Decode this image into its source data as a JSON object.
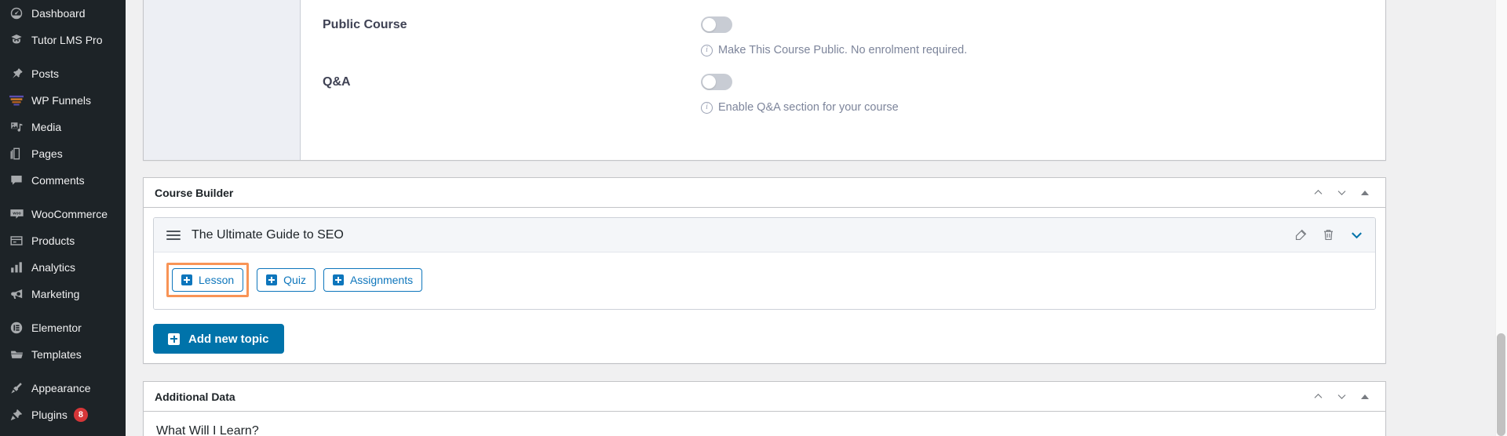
{
  "sidebar": {
    "items": [
      {
        "label": "Dashboard",
        "icon": "dashboard-icon",
        "separator_after": false
      },
      {
        "label": "Tutor LMS Pro",
        "icon": "tutor-lms-icon",
        "separator_after": true
      },
      {
        "label": "Posts",
        "icon": "pin-icon",
        "separator_after": false
      },
      {
        "label": "WP Funnels",
        "icon": "funnel-icon",
        "separator_after": false
      },
      {
        "label": "Media",
        "icon": "media-icon",
        "separator_after": false
      },
      {
        "label": "Pages",
        "icon": "pages-icon",
        "separator_after": false
      },
      {
        "label": "Comments",
        "icon": "comments-icon",
        "separator_after": true
      },
      {
        "label": "WooCommerce",
        "icon": "woocommerce-icon",
        "separator_after": false
      },
      {
        "label": "Products",
        "icon": "products-icon",
        "separator_after": false
      },
      {
        "label": "Analytics",
        "icon": "analytics-icon",
        "separator_after": false
      },
      {
        "label": "Marketing",
        "icon": "marketing-icon",
        "separator_after": true
      },
      {
        "label": "Elementor",
        "icon": "elementor-icon",
        "separator_after": false
      },
      {
        "label": "Templates",
        "icon": "templates-icon",
        "separator_after": true
      },
      {
        "label": "Appearance",
        "icon": "appearance-icon",
        "separator_after": false
      },
      {
        "label": "Plugins",
        "icon": "plugins-icon",
        "separator_after": false,
        "badge": "8"
      }
    ]
  },
  "settings_panel": {
    "fields": [
      {
        "label": "Public Course",
        "toggle_on": false,
        "help": "Make This Course Public. No enrolment required."
      },
      {
        "label": "Q&A",
        "toggle_on": false,
        "help": "Enable Q&A section for your course"
      }
    ]
  },
  "course_builder": {
    "title": "Course Builder",
    "topic": {
      "title": "The Ultimate Guide to SEO",
      "buttons": [
        {
          "label": "Lesson",
          "highlighted": true
        },
        {
          "label": "Quiz",
          "highlighted": false
        },
        {
          "label": "Assignments",
          "highlighted": false
        }
      ]
    },
    "add_topic_label": "Add new topic"
  },
  "additional_data": {
    "title": "Additional Data",
    "first_field_label": "What Will I Learn?"
  },
  "colors": {
    "accent_blue": "#0073aa",
    "button_blue": "#0e76bc",
    "highlight_orange": "#f89456",
    "admin_bg": "#1d2327",
    "badge_red": "#d63638"
  }
}
